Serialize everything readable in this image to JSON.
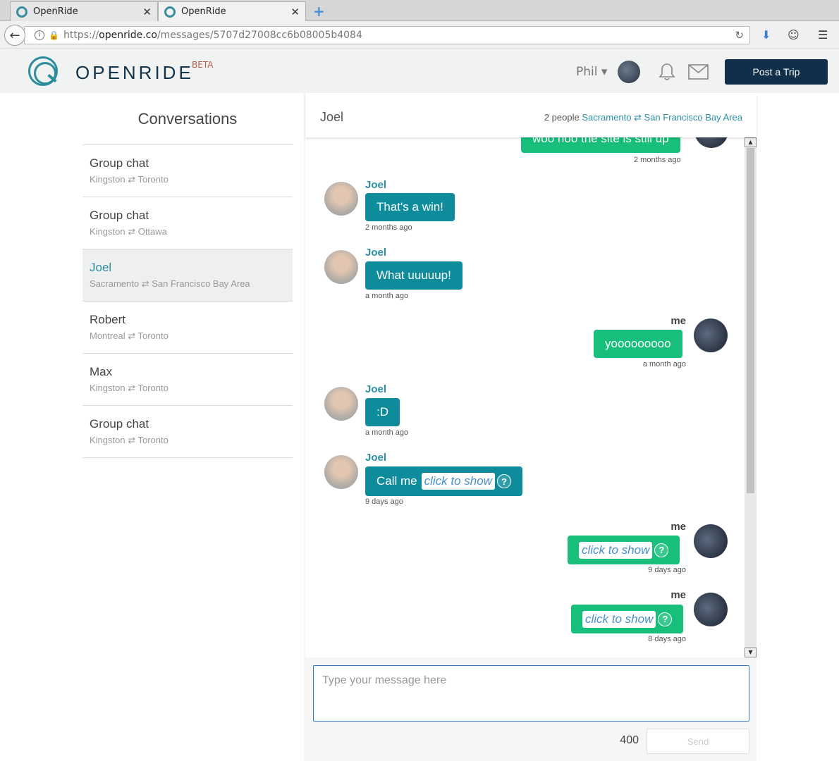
{
  "browser": {
    "tabs": [
      {
        "title": "OpenRide"
      },
      {
        "title": "OpenRide"
      }
    ],
    "url_prefix": "https://",
    "url_domain": "openride.co",
    "url_path": "/messages/5707d27008cc6b08005b4084"
  },
  "header": {
    "logo_text": "OPENRIDE",
    "beta_label": "BETA",
    "user_name": "Phil ▾",
    "post_trip_label": "Post a Trip"
  },
  "sidebar": {
    "title": "Conversations",
    "conversations": [
      {
        "name": "Group chat",
        "route": "Kingston ⇄ Toronto"
      },
      {
        "name": "Group chat",
        "route": "Kingston ⇄ Ottawa"
      },
      {
        "name": "Joel",
        "route": "Sacramento ⇄ San Francisco Bay Area"
      },
      {
        "name": "Robert",
        "route": "Montreal ⇄ Toronto"
      },
      {
        "name": "Max",
        "route": "Kingston ⇄ Toronto"
      },
      {
        "name": "Group chat",
        "route": "Kingston ⇄ Toronto"
      }
    ]
  },
  "chat": {
    "with": "Joel",
    "people_count": "2 people",
    "route": "Sacramento ⇄ San Francisco Bay Area",
    "messages": [
      {
        "sender": "",
        "text": "woo hoo the site is still up",
        "time": "2 months ago"
      },
      {
        "sender": "Joel",
        "text": "That's a win!",
        "time": "2 months ago"
      },
      {
        "sender": "Joel",
        "text": "What uuuuup!",
        "time": "a month ago"
      },
      {
        "sender": "me",
        "text": "yooooooooo",
        "time": "a month ago"
      },
      {
        "sender": "Joel",
        "text": ":D",
        "time": "a month ago"
      },
      {
        "sender": "Joel",
        "text": "Call me",
        "hidden": "click to show",
        "time": "9 days ago"
      },
      {
        "sender": "me",
        "hidden": "click to show",
        "time": "9 days ago"
      },
      {
        "sender": "me",
        "hidden": "click to show",
        "time": "8 days ago"
      }
    ],
    "help_glyph": "?"
  },
  "composer": {
    "placeholder": "Type your message here",
    "char_count": "400",
    "send_label": "Send"
  },
  "colors": {
    "brand_dark": "#0f2f4a",
    "brand_teal": "#2c8fa3",
    "bubble_joel": "#0f8c9c",
    "bubble_me": "#17bf7a"
  }
}
